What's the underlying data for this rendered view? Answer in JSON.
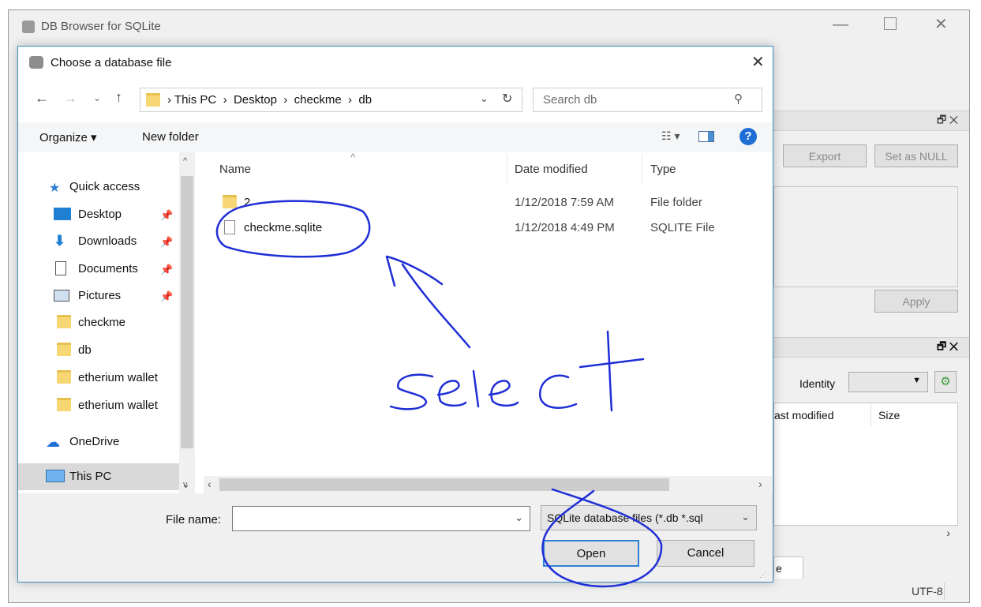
{
  "main_window": {
    "title": "DB Browser for SQLite",
    "panel_buttons": {
      "export": "Export",
      "set_null": "Set as NULL",
      "apply": "Apply"
    },
    "identity_label": "Identity",
    "columns": {
      "last_modified": "ast modified",
      "size": "Size"
    },
    "tab_fragment": "e",
    "encoding": "UTF-8"
  },
  "dialog": {
    "title": "Choose a database file",
    "breadcrumb": [
      "This PC",
      "Desktop",
      "checkme",
      "db"
    ],
    "search_placeholder": "Search db",
    "toolbar": {
      "organize": "Organize ▾",
      "new_folder": "New folder"
    },
    "nav": {
      "quick_access": "Quick access",
      "items": [
        {
          "label": "Desktop",
          "icon": "desktop-icon",
          "pinned": true
        },
        {
          "label": "Downloads",
          "icon": "download-icon",
          "pinned": true
        },
        {
          "label": "Documents",
          "icon": "documents-icon",
          "pinned": true
        },
        {
          "label": "Pictures",
          "icon": "pictures-icon",
          "pinned": true
        },
        {
          "label": "checkme",
          "icon": "folder-icon",
          "pinned": false
        },
        {
          "label": "db",
          "icon": "folder-icon",
          "pinned": false
        },
        {
          "label": "etherium wallet",
          "icon": "folder-icon",
          "pinned": false
        },
        {
          "label": "etherium wallet",
          "icon": "folder-icon",
          "pinned": false
        }
      ],
      "onedrive": "OneDrive",
      "this_pc": "This PC"
    },
    "columns": {
      "name": "Name",
      "date": "Date modified",
      "type": "Type"
    },
    "files": [
      {
        "name": "2",
        "date": "1/12/2018 7:59 AM",
        "type": "File folder",
        "icon": "folder-icon"
      },
      {
        "name": "checkme.sqlite",
        "date": "1/12/2018 4:49 PM",
        "type": "SQLITE File",
        "icon": "file-icon"
      }
    ],
    "filename_label": "File name:",
    "filename_value": "",
    "filter": "SQLite database files (*.db *.sql",
    "open_label": "Open",
    "cancel_label": "Cancel"
  },
  "annotation": {
    "text": "select",
    "color": "#1f2fd6"
  }
}
